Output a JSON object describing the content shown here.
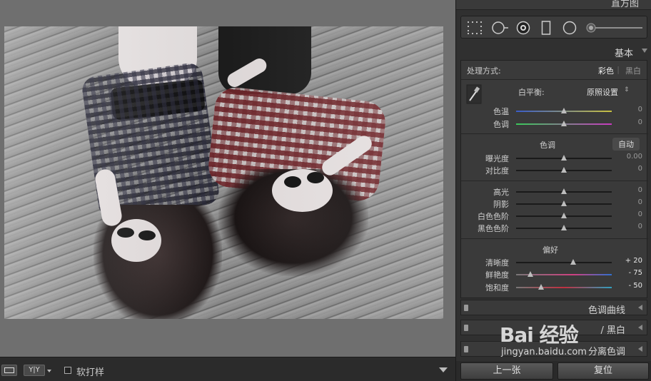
{
  "panel": {
    "histogram_label": "直方图",
    "basic_label": "基本",
    "treatment": {
      "label": "处理方式:",
      "color": "彩色",
      "bw": "黑白"
    },
    "white_balance": {
      "label": "白平衡:",
      "value": "原照设置"
    },
    "temp": {
      "label": "色温",
      "value": "0",
      "pos": 0.5
    },
    "tint": {
      "label": "色调",
      "value": "0",
      "pos": 0.5
    },
    "tone_header": "色调",
    "auto_label": "自动",
    "exposure": {
      "label": "曝光度",
      "value": "0.00",
      "pos": 0.5
    },
    "contrast": {
      "label": "对比度",
      "value": "0",
      "pos": 0.5
    },
    "highlights": {
      "label": "高光",
      "value": "0",
      "pos": 0.5
    },
    "shadows": {
      "label": "阴影",
      "value": "0",
      "pos": 0.5
    },
    "whites": {
      "label": "白色色阶",
      "value": "0",
      "pos": 0.5
    },
    "blacks": {
      "label": "黑色色阶",
      "value": "0",
      "pos": 0.5
    },
    "presence_header": "偏好",
    "clarity": {
      "label": "清晰度",
      "value": "+ 20",
      "pos": 0.6
    },
    "vibrance": {
      "label": "鲜艳度",
      "value": "- 75",
      "pos": 0.125
    },
    "saturation": {
      "label": "饱和度",
      "value": "- 50",
      "pos": 0.25
    },
    "tone_curve": "色调曲线",
    "hsl_bw": "/ 黑白",
    "split_tone": "分离色调",
    "prev_button": "上一张",
    "reset_button": "复位"
  },
  "toolbar": {
    "yy_label": "Y|Y",
    "soft_proof_label": "软打样"
  },
  "watermark": {
    "main": "Bai 经验",
    "sub": "jingyan.baidu.com"
  }
}
